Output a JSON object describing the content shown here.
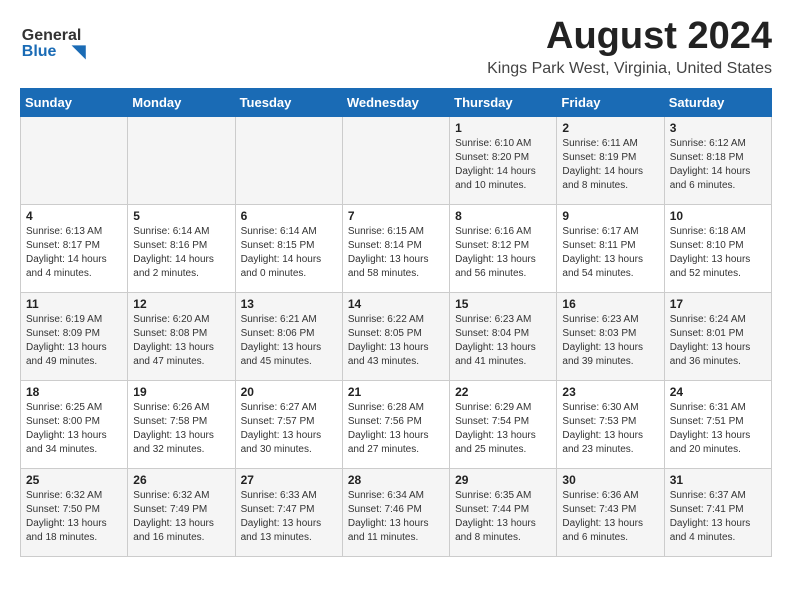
{
  "header": {
    "logo_line1": "General",
    "logo_line2": "Blue",
    "month_year": "August 2024",
    "location": "Kings Park West, Virginia, United States"
  },
  "calendar": {
    "days_of_week": [
      "Sunday",
      "Monday",
      "Tuesday",
      "Wednesday",
      "Thursday",
      "Friday",
      "Saturday"
    ],
    "weeks": [
      [
        {
          "day": "",
          "info": ""
        },
        {
          "day": "",
          "info": ""
        },
        {
          "day": "",
          "info": ""
        },
        {
          "day": "",
          "info": ""
        },
        {
          "day": "1",
          "info": "Sunrise: 6:10 AM\nSunset: 8:20 PM\nDaylight: 14 hours\nand 10 minutes."
        },
        {
          "day": "2",
          "info": "Sunrise: 6:11 AM\nSunset: 8:19 PM\nDaylight: 14 hours\nand 8 minutes."
        },
        {
          "day": "3",
          "info": "Sunrise: 6:12 AM\nSunset: 8:18 PM\nDaylight: 14 hours\nand 6 minutes."
        }
      ],
      [
        {
          "day": "4",
          "info": "Sunrise: 6:13 AM\nSunset: 8:17 PM\nDaylight: 14 hours\nand 4 minutes."
        },
        {
          "day": "5",
          "info": "Sunrise: 6:14 AM\nSunset: 8:16 PM\nDaylight: 14 hours\nand 2 minutes."
        },
        {
          "day": "6",
          "info": "Sunrise: 6:14 AM\nSunset: 8:15 PM\nDaylight: 14 hours\nand 0 minutes."
        },
        {
          "day": "7",
          "info": "Sunrise: 6:15 AM\nSunset: 8:14 PM\nDaylight: 13 hours\nand 58 minutes."
        },
        {
          "day": "8",
          "info": "Sunrise: 6:16 AM\nSunset: 8:12 PM\nDaylight: 13 hours\nand 56 minutes."
        },
        {
          "day": "9",
          "info": "Sunrise: 6:17 AM\nSunset: 8:11 PM\nDaylight: 13 hours\nand 54 minutes."
        },
        {
          "day": "10",
          "info": "Sunrise: 6:18 AM\nSunset: 8:10 PM\nDaylight: 13 hours\nand 52 minutes."
        }
      ],
      [
        {
          "day": "11",
          "info": "Sunrise: 6:19 AM\nSunset: 8:09 PM\nDaylight: 13 hours\nand 49 minutes."
        },
        {
          "day": "12",
          "info": "Sunrise: 6:20 AM\nSunset: 8:08 PM\nDaylight: 13 hours\nand 47 minutes."
        },
        {
          "day": "13",
          "info": "Sunrise: 6:21 AM\nSunset: 8:06 PM\nDaylight: 13 hours\nand 45 minutes."
        },
        {
          "day": "14",
          "info": "Sunrise: 6:22 AM\nSunset: 8:05 PM\nDaylight: 13 hours\nand 43 minutes."
        },
        {
          "day": "15",
          "info": "Sunrise: 6:23 AM\nSunset: 8:04 PM\nDaylight: 13 hours\nand 41 minutes."
        },
        {
          "day": "16",
          "info": "Sunrise: 6:23 AM\nSunset: 8:03 PM\nDaylight: 13 hours\nand 39 minutes."
        },
        {
          "day": "17",
          "info": "Sunrise: 6:24 AM\nSunset: 8:01 PM\nDaylight: 13 hours\nand 36 minutes."
        }
      ],
      [
        {
          "day": "18",
          "info": "Sunrise: 6:25 AM\nSunset: 8:00 PM\nDaylight: 13 hours\nand 34 minutes."
        },
        {
          "day": "19",
          "info": "Sunrise: 6:26 AM\nSunset: 7:58 PM\nDaylight: 13 hours\nand 32 minutes."
        },
        {
          "day": "20",
          "info": "Sunrise: 6:27 AM\nSunset: 7:57 PM\nDaylight: 13 hours\nand 30 minutes."
        },
        {
          "day": "21",
          "info": "Sunrise: 6:28 AM\nSunset: 7:56 PM\nDaylight: 13 hours\nand 27 minutes."
        },
        {
          "day": "22",
          "info": "Sunrise: 6:29 AM\nSunset: 7:54 PM\nDaylight: 13 hours\nand 25 minutes."
        },
        {
          "day": "23",
          "info": "Sunrise: 6:30 AM\nSunset: 7:53 PM\nDaylight: 13 hours\nand 23 minutes."
        },
        {
          "day": "24",
          "info": "Sunrise: 6:31 AM\nSunset: 7:51 PM\nDaylight: 13 hours\nand 20 minutes."
        }
      ],
      [
        {
          "day": "25",
          "info": "Sunrise: 6:32 AM\nSunset: 7:50 PM\nDaylight: 13 hours\nand 18 minutes."
        },
        {
          "day": "26",
          "info": "Sunrise: 6:32 AM\nSunset: 7:49 PM\nDaylight: 13 hours\nand 16 minutes."
        },
        {
          "day": "27",
          "info": "Sunrise: 6:33 AM\nSunset: 7:47 PM\nDaylight: 13 hours\nand 13 minutes."
        },
        {
          "day": "28",
          "info": "Sunrise: 6:34 AM\nSunset: 7:46 PM\nDaylight: 13 hours\nand 11 minutes."
        },
        {
          "day": "29",
          "info": "Sunrise: 6:35 AM\nSunset: 7:44 PM\nDaylight: 13 hours\nand 8 minutes."
        },
        {
          "day": "30",
          "info": "Sunrise: 6:36 AM\nSunset: 7:43 PM\nDaylight: 13 hours\nand 6 minutes."
        },
        {
          "day": "31",
          "info": "Sunrise: 6:37 AM\nSunset: 7:41 PM\nDaylight: 13 hours\nand 4 minutes."
        }
      ]
    ]
  }
}
